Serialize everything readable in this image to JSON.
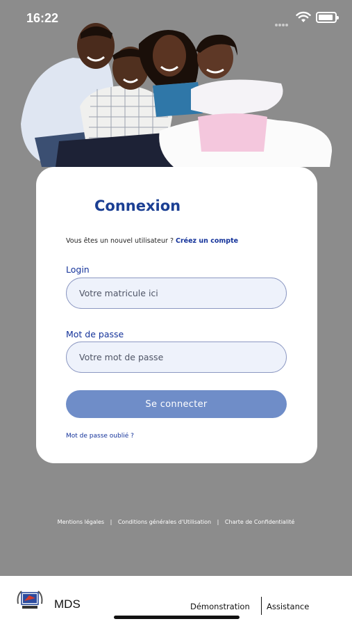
{
  "status_bar": {
    "time": "16:22"
  },
  "login_card": {
    "title": "Connexion",
    "signup_prompt": "Vous êtes un nouvel utilisateur ? ",
    "signup_link": "Créez un compte",
    "login_label": "Login",
    "login_placeholder": "Votre matricule ici",
    "login_value": "",
    "password_label": "Mot de passe",
    "password_placeholder": "Votre mot de passe",
    "password_value": "",
    "submit_label": "Se connecter",
    "forgot_password": "Mot de passe oublié ?"
  },
  "legal_links": {
    "mentions": "Mentions légales",
    "cgu": "Conditions générales d'Utilisation",
    "privacy": "Charte de Confidentialité",
    "separator": "|"
  },
  "bottom_bar": {
    "logo_text": "MDS",
    "demo": "Démonstration",
    "assistance": "Assistance"
  },
  "colors": {
    "background": "#8c8c8c",
    "primary": "#1b3f93",
    "button": "#6f8dc8",
    "input_bg": "#eef2fb"
  },
  "icons": [
    "wifi-icon",
    "battery-icon",
    "signal-icon",
    "logo-emblem"
  ]
}
